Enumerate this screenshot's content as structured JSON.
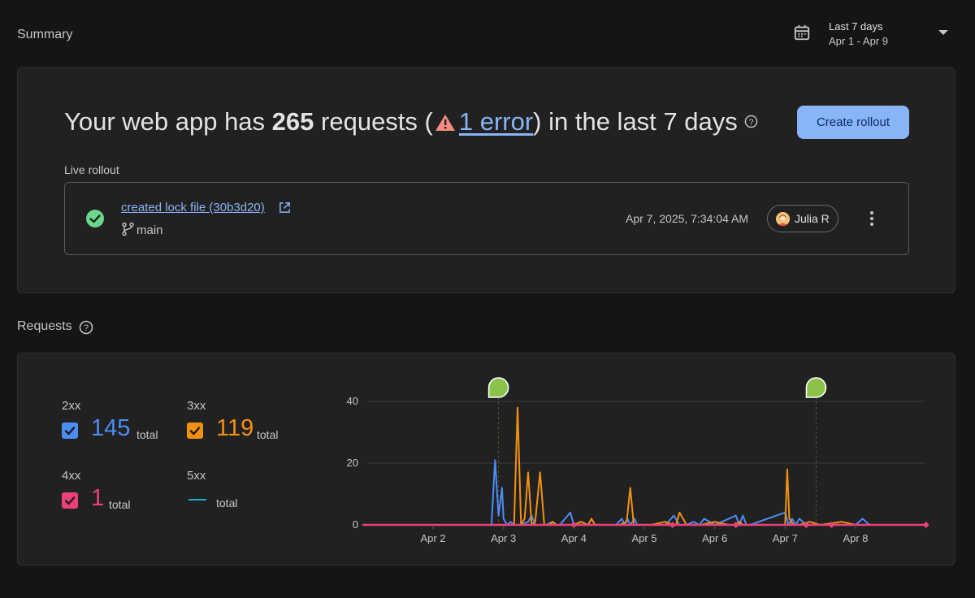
{
  "header": {
    "title": "Summary",
    "date_range_label": "Last 7 days",
    "date_range_dates": "Apr 1 - Apr 9"
  },
  "summary": {
    "headline_prefix": "Your web app has ",
    "request_count": "265",
    "headline_mid": " requests (",
    "error_link": "1 error",
    "headline_suffix": ") in the last 7 days",
    "create_button": "Create rollout",
    "live_rollout_label": "Live rollout",
    "rollout": {
      "commit": "created lock file (30b3d20)",
      "branch": "main",
      "timestamp": "Apr 7, 2025, 7:34:04 AM",
      "user": "Julia R",
      "status": "success"
    }
  },
  "requests": {
    "title": "Requests",
    "legend": [
      {
        "code": "2xx",
        "value": "145",
        "total_label": "total",
        "color": "#4c8df6",
        "checked": true
      },
      {
        "code": "3xx",
        "value": "119",
        "total_label": "total",
        "color": "#f29111",
        "checked": true
      },
      {
        "code": "4xx",
        "value": "1",
        "total_label": "total",
        "color": "#ec407a",
        "checked": true
      },
      {
        "code": "5xx",
        "value": "",
        "total_label": "total",
        "color": "#12b5cb",
        "checked": false
      }
    ]
  },
  "colors": {
    "background": "#151515",
    "card": "#212121",
    "accent_blue": "#8ab4f8",
    "success_green": "#6dd58c",
    "warning_red": "#f28b82",
    "marker_green": "#8bc34a"
  },
  "chart_data": {
    "type": "line",
    "x_tick_labels": [
      "Apr 2",
      "Apr 3",
      "Apr 4",
      "Apr 5",
      "Apr 6",
      "Apr 7",
      "Apr 8"
    ],
    "y_tick_labels": [
      "0",
      "20",
      "40"
    ],
    "ylim": [
      0,
      45
    ],
    "xlim": [
      1.0,
      9.0
    ],
    "grid": true,
    "rollout_markers": [
      2.93,
      7.44
    ],
    "series": [
      {
        "name": "2xx",
        "color": "#4c8df6",
        "x": [
          1.0,
          2.83,
          2.88,
          2.93,
          2.98,
          3.0,
          3.05,
          3.1,
          3.15,
          3.25,
          3.35,
          3.4,
          3.45,
          3.6,
          3.7,
          3.75,
          3.8,
          3.95,
          4.0,
          4.1,
          4.2,
          4.3,
          4.5,
          4.6,
          4.68,
          4.72,
          4.76,
          4.8,
          4.86,
          4.9,
          4.95,
          5.1,
          5.2,
          5.3,
          5.42,
          5.5,
          5.6,
          5.7,
          5.78,
          5.85,
          6.0,
          6.3,
          6.35,
          6.4,
          6.45,
          6.5,
          7.0,
          7.05,
          7.1,
          7.15,
          7.2,
          7.3,
          7.5,
          8.0,
          8.1,
          8.2,
          9.0
        ],
        "y": [
          0,
          0,
          21,
          3,
          12,
          2,
          0,
          1,
          0,
          0,
          1,
          3,
          0,
          0,
          1,
          0,
          0,
          4,
          0,
          0,
          0,
          0,
          0,
          0,
          2,
          0,
          2,
          0,
          2,
          0,
          0,
          0,
          0,
          0,
          3,
          0,
          0,
          1,
          0,
          2,
          0,
          3,
          0,
          3,
          0,
          0,
          4,
          0,
          2,
          0,
          2,
          0,
          0,
          0,
          2,
          0,
          0
        ]
      },
      {
        "name": "3xx",
        "color": "#f29111",
        "x": [
          1.0,
          3.15,
          3.2,
          3.25,
          3.3,
          3.35,
          3.4,
          3.45,
          3.52,
          3.58,
          3.65,
          3.7,
          3.75,
          3.9,
          4.0,
          4.1,
          4.2,
          4.25,
          4.3,
          4.4,
          4.65,
          4.75,
          4.8,
          4.85,
          4.95,
          5.1,
          5.3,
          5.4,
          5.45,
          5.5,
          5.6,
          5.8,
          6.0,
          6.2,
          6.3,
          6.35,
          6.4,
          6.6,
          6.75,
          6.85,
          7.0,
          7.03,
          7.06,
          7.12,
          7.2,
          7.35,
          7.5,
          7.8,
          8.0,
          9.0
        ],
        "y": [
          0,
          0,
          38,
          0,
          2,
          17,
          0,
          1,
          17,
          0,
          0,
          1,
          0,
          0,
          0,
          1,
          0,
          2,
          0,
          0,
          0,
          1,
          12,
          0,
          0,
          0,
          1,
          0,
          0,
          4,
          0,
          0,
          1,
          0,
          0,
          1,
          0,
          0,
          0,
          0,
          0,
          18,
          2,
          0,
          0,
          1,
          0,
          1,
          0,
          0
        ]
      },
      {
        "name": "4xx",
        "color": "#ec407a",
        "x": [
          1.0,
          9.0
        ],
        "y": [
          0,
          0
        ]
      }
    ]
  }
}
